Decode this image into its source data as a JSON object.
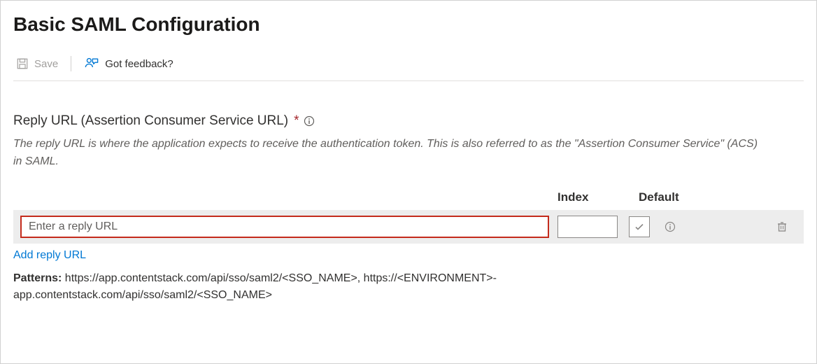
{
  "header": {
    "title": "Basic SAML Configuration"
  },
  "toolbar": {
    "save_label": "Save",
    "feedback_label": "Got feedback?"
  },
  "section": {
    "label": "Reply URL (Assertion Consumer Service URL)",
    "required_marker": "*",
    "description": "The reply URL is where the application expects to receive the authentication token. This is also referred to as the \"Assertion Consumer Service\" (ACS) in SAML."
  },
  "columns": {
    "index": "Index",
    "default": "Default"
  },
  "row": {
    "url_placeholder": "Enter a reply URL",
    "url_value": "",
    "index_value": ""
  },
  "add_link": "Add reply URL",
  "patterns": {
    "label": "Patterns:",
    "text": " https://app.contentstack.com/api/sso/saml2/<SSO_NAME>, https://<ENVIRONMENT>-app.contentstack.com/api/sso/saml2/<SSO_NAME>"
  }
}
